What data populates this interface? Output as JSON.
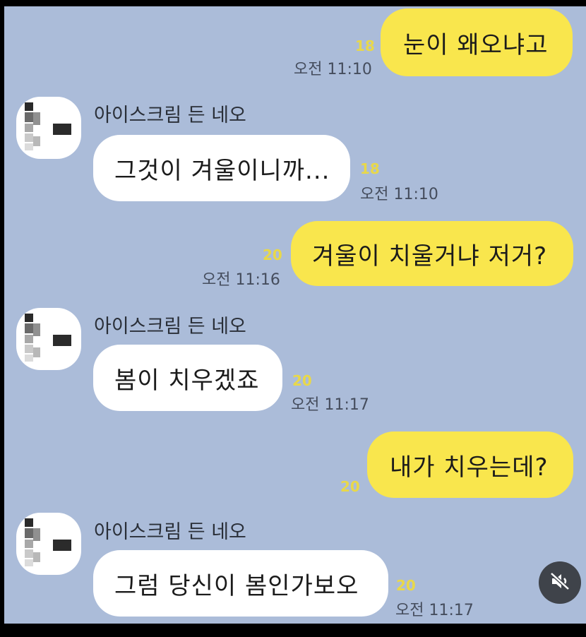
{
  "contact": {
    "name": "아이스크림 든 네오"
  },
  "messages": [
    {
      "from": "me",
      "text": "눈이 왜오냐고",
      "read": "18",
      "time": "오전 11:10"
    },
    {
      "from": "them",
      "sender": "아이스크림 든 네오",
      "text": "그것이 겨울이니까...",
      "read": "18",
      "time": "오전 11:10"
    },
    {
      "from": "me",
      "text": "겨울이 치울거냐 저거?",
      "read": "20",
      "time": "오전 11:16"
    },
    {
      "from": "them",
      "sender": "아이스크림 든 네오",
      "text": "봄이 치우겠죠",
      "read": "20",
      "time": "오전 11:17"
    },
    {
      "from": "me",
      "text": "내가 치우는데?",
      "read": "20",
      "time": ""
    },
    {
      "from": "them",
      "sender": "아이스크림 든 네오",
      "text": "그럼 당신이 봄인가보오",
      "read": "20",
      "time": "오전 11:17"
    }
  ],
  "icons": {
    "mute": "speaker-muted-icon",
    "avatar": "pixelated-avatar"
  },
  "colors": {
    "background": "#abbcd9",
    "my_bubble": "#f9e64d",
    "their_bubble": "#ffffff",
    "read_count": "#e8d84a"
  }
}
